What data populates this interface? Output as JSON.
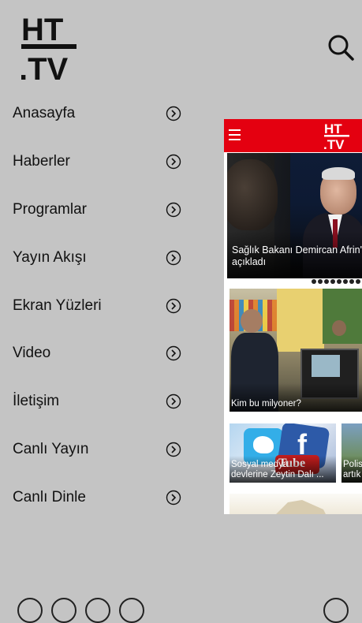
{
  "header": {
    "logo_line1": "HT",
    "logo_line2": ".TV",
    "search_icon": "search-icon"
  },
  "menu": {
    "items": [
      {
        "label": "Anasayfa",
        "icon": "chevron-right-circle-icon"
      },
      {
        "label": "Haberler",
        "icon": "chevron-right-circle-icon"
      },
      {
        "label": "Programlar",
        "icon": "chevron-right-circle-icon"
      },
      {
        "label": "Yayın Akışı",
        "icon": "chevron-right-circle-icon"
      },
      {
        "label": "Ekran Yüzleri",
        "icon": "chevron-right-circle-icon"
      },
      {
        "label": "Video",
        "icon": "chevron-right-circle-icon"
      },
      {
        "label": "İletişim",
        "icon": "chevron-right-circle-icon"
      },
      {
        "label": "Canlı Yayın",
        "icon": "chevron-right-circle-icon"
      },
      {
        "label": "Canlı Dinle",
        "icon": "chevron-right-circle-icon"
      }
    ]
  },
  "preview": {
    "bar_color": "#e40010",
    "logo_line1": "HT",
    "logo_line2": ".TV",
    "hero_caption_line1": "Sağlık Bakanı Demircan Afrin'",
    "hero_caption_line2": "açıkladı",
    "card2_caption": "Kim bu milyoner?",
    "card3_caption_line1": "Sosyal medya",
    "card3_caption_line2": "devlerine Zeytin Dalı ...",
    "card4_caption_line1": "Polis",
    "card4_caption_line2": "artık"
  },
  "colors": {
    "background": "#c4c4c4",
    "accent_red": "#e40010"
  }
}
